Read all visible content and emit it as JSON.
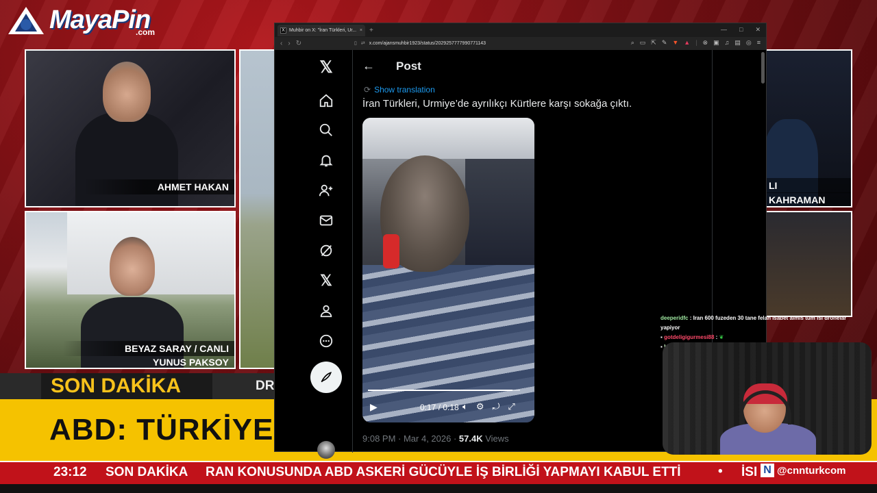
{
  "broadcast": {
    "logo_text": "MayaPin",
    "logo_domain": ".com",
    "panels": [
      {
        "name_line1": "AHMET HAKAN",
        "name_line2": ""
      },
      {
        "name_line1": "BEYAZ SARAY / CANLI",
        "name_line2": "YUNUS PAKSOY"
      },
      {
        "name_line1": "LI",
        "name_line2": "KAHRAMAN"
      }
    ],
    "breaking_tag": "SON DAKİKA",
    "breaking_tag_partial": "DR",
    "headline": "ABD: TÜRKİYE",
    "ticker": {
      "time": "23:12",
      "label": "SON DAKİKA",
      "text": "RAN KONUSUNDA ABD ASKERİ GÜCÜYLE İŞ BİRLİĞİ YAPMAYI KABUL ETTİ",
      "bullet": "•",
      "next": "İSI"
    },
    "channel_handle": "@cnnturkcom",
    "channel_icon": "N"
  },
  "browser": {
    "tab_title": "Muhbir on X: \"İran Türkleri, Ur...",
    "tab_favicon": "X",
    "url": "x.com/ajansmuhbir1923/status/2029257777990771143",
    "win_controls": [
      "—",
      "□",
      "✕"
    ]
  },
  "x": {
    "page_title": "Post",
    "show_translation": "Show translation",
    "tweet_text": "İran Türkleri, Urmiye’de ayrılıkçı Kürtlere karşı sokağa çıktı.",
    "video": {
      "current_time": "0:17",
      "duration": "0:18",
      "time_label": "0:17 / 0:18",
      "progress": 0.95
    },
    "timestamp": "9:08 PM · Mar 4, 2026 · ",
    "views_count": "57.4K",
    "views_label": " Views",
    "sidebar_icons": [
      "x-logo-icon",
      "home-icon",
      "search-icon",
      "notifications-icon",
      "follow-icon",
      "messages-icon",
      "grok-icon",
      "premium-icon",
      "profile-icon",
      "more-icon"
    ]
  },
  "chat": [
    {
      "user": "deeperidfc",
      "message": ": Iran 600 fuzeden 30 tane felan isabet almis tum isi dronelar yapiyor"
    },
    {
      "user": "gotdeligigurmesi88",
      "message": ":"
    },
    {
      "user": "bensenibeenmedimcanimya",
      "message": ":"
    }
  ],
  "colors": {
    "accent_red": "#c1121a",
    "breaking_yellow": "#f5c200",
    "x_blue": "#1d9bf0"
  }
}
